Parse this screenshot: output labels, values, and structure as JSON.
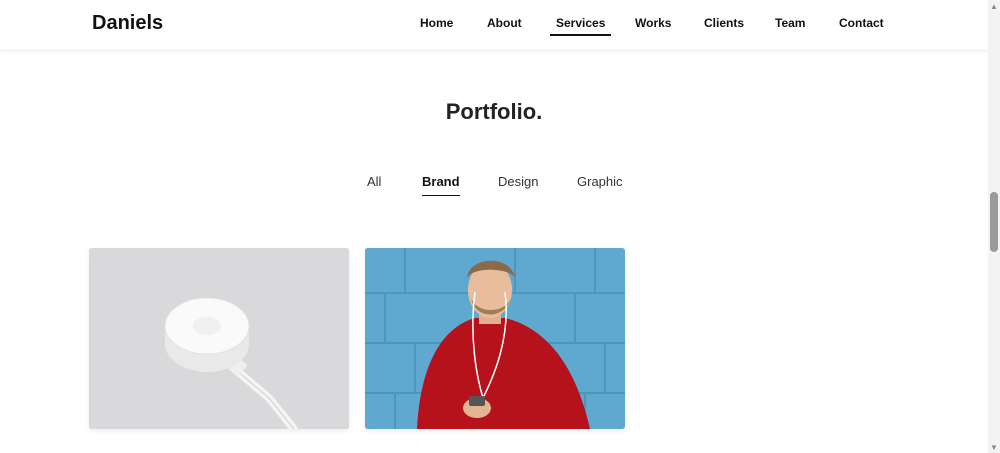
{
  "header": {
    "brand": "Daniels",
    "nav": [
      {
        "label": "Home"
      },
      {
        "label": "About"
      },
      {
        "label": "Services",
        "active": true
      },
      {
        "label": "Works"
      },
      {
        "label": "Clients"
      },
      {
        "label": "Team"
      },
      {
        "label": "Contact"
      }
    ]
  },
  "portfolio": {
    "title": "Portfolio.",
    "filters": [
      {
        "label": "All"
      },
      {
        "label": "Brand",
        "active": true
      },
      {
        "label": "Design"
      },
      {
        "label": "Graphic"
      }
    ],
    "items": [
      {
        "image": "white wireless charger on grey background"
      },
      {
        "image": "smiling man in red sweater with earphones against blue wall"
      }
    ]
  },
  "colors": {
    "text": "#111111",
    "card_grey": "#d9d9db",
    "card_blue_wall": "#5fa8d0",
    "sweater_red": "#b5121b"
  }
}
